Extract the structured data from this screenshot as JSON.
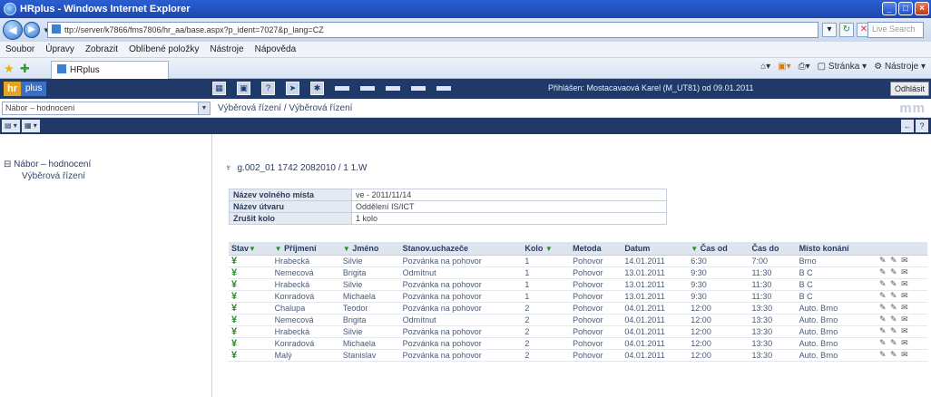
{
  "window": {
    "title": "HRplus - Windows Internet Explorer"
  },
  "address": {
    "url": "ttp://server/k7866/fms7806/hr_aa/base.aspx?p_ident=7027&p_lang=CZ",
    "search_placeholder": "Live Search"
  },
  "menu": [
    "Soubor",
    "Úpravy",
    "Zobrazit",
    "Oblíbené položky",
    "Nástroje",
    "Nápověda"
  ],
  "tab": {
    "label": "HRplus"
  },
  "commandbar": {
    "page": "Stránka",
    "tools": "Nástroje"
  },
  "app": {
    "logo_hr": "hr",
    "logo_plus": "plus",
    "user_info": "Přihlášen: Mostacavaová Karel (M_UT81) od 09.01.2011",
    "logout": "Odhlásit",
    "select": "Nábor – hodnocení",
    "breadcrumb": "Výběrová řízení / Výběrová řízení",
    "brand": "mm"
  },
  "sidebar": {
    "root": "Nábor – hodnocení",
    "child": "Výběrová řízení"
  },
  "main": {
    "heading": "g.002_01 1742 2082010 / 1 1.W",
    "info": [
      {
        "label": "Název volného místa",
        "value": "ve - 2011/11/14"
      },
      {
        "label": "Název útvaru",
        "value": "Oddělení IS/ICT"
      },
      {
        "label": "Zrušit kolo",
        "value": "1 kolo"
      }
    ],
    "columns": [
      "Stav",
      "Příjmení",
      "Jméno",
      "Stanov.uchazeče",
      "Kolo",
      "Metoda",
      "Datum",
      "Čas od",
      "Čas do",
      "Místo konání",
      ""
    ],
    "rows": [
      [
        "Hrabecká",
        "Silvie",
        "Pozvánka na pohovor",
        "1",
        "Pohovor",
        "14.01.2011",
        "6:30",
        "7:00",
        "Brno",
        "✎ ✎ ✉"
      ],
      [
        "Nemecová",
        "Brigita",
        "Odmítnut",
        "1",
        "Pohovor",
        "13.01.2011",
        "9:30",
        "11:30",
        "B C",
        "✎ ✎ ✉"
      ],
      [
        "Hrabecká",
        "Silvie",
        "Pozvánka na pohovor",
        "1",
        "Pohovor",
        "13.01.2011",
        "9:30",
        "11:30",
        "B C",
        "✎ ✎ ✉"
      ],
      [
        "Konradová",
        "Michaela",
        "Pozvánka na pohovor",
        "1",
        "Pohovor",
        "13.01.2011",
        "9:30",
        "11:30",
        "B C",
        "✎ ✎ ✉"
      ],
      [
        "Chalupa",
        "Teodor",
        "Pozvánka na pohovor",
        "2",
        "Pohovor",
        "04.01.2011",
        "12:00",
        "13:30",
        "Auto. Brno",
        "✎ ✎ ✉"
      ],
      [
        "Nemecová",
        "Brigita",
        "Odmítnut",
        "2",
        "Pohovor",
        "04.01.2011",
        "12:00",
        "13:30",
        "Auto. Brno",
        "✎ ✎ ✉"
      ],
      [
        "Hrabecká",
        "Silvie",
        "Pozvánka na pohovor",
        "2",
        "Pohovor",
        "04.01.2011",
        "12:00",
        "13:30",
        "Auto. Brno",
        "✎ ✎ ✉"
      ],
      [
        "Konradová",
        "Michaela",
        "Pozvánka na pohovor",
        "2",
        "Pohovor",
        "04.01.2011",
        "12:00",
        "13:30",
        "Auto. Brno",
        "✎ ✎ ✉"
      ],
      [
        "Malý",
        "Stanislav",
        "Pozvánka na pohovor",
        "2",
        "Pohovor",
        "04.01.2011",
        "12:00",
        "13:30",
        "Auto. Brno",
        "✎ ✎ ✉"
      ]
    ]
  }
}
